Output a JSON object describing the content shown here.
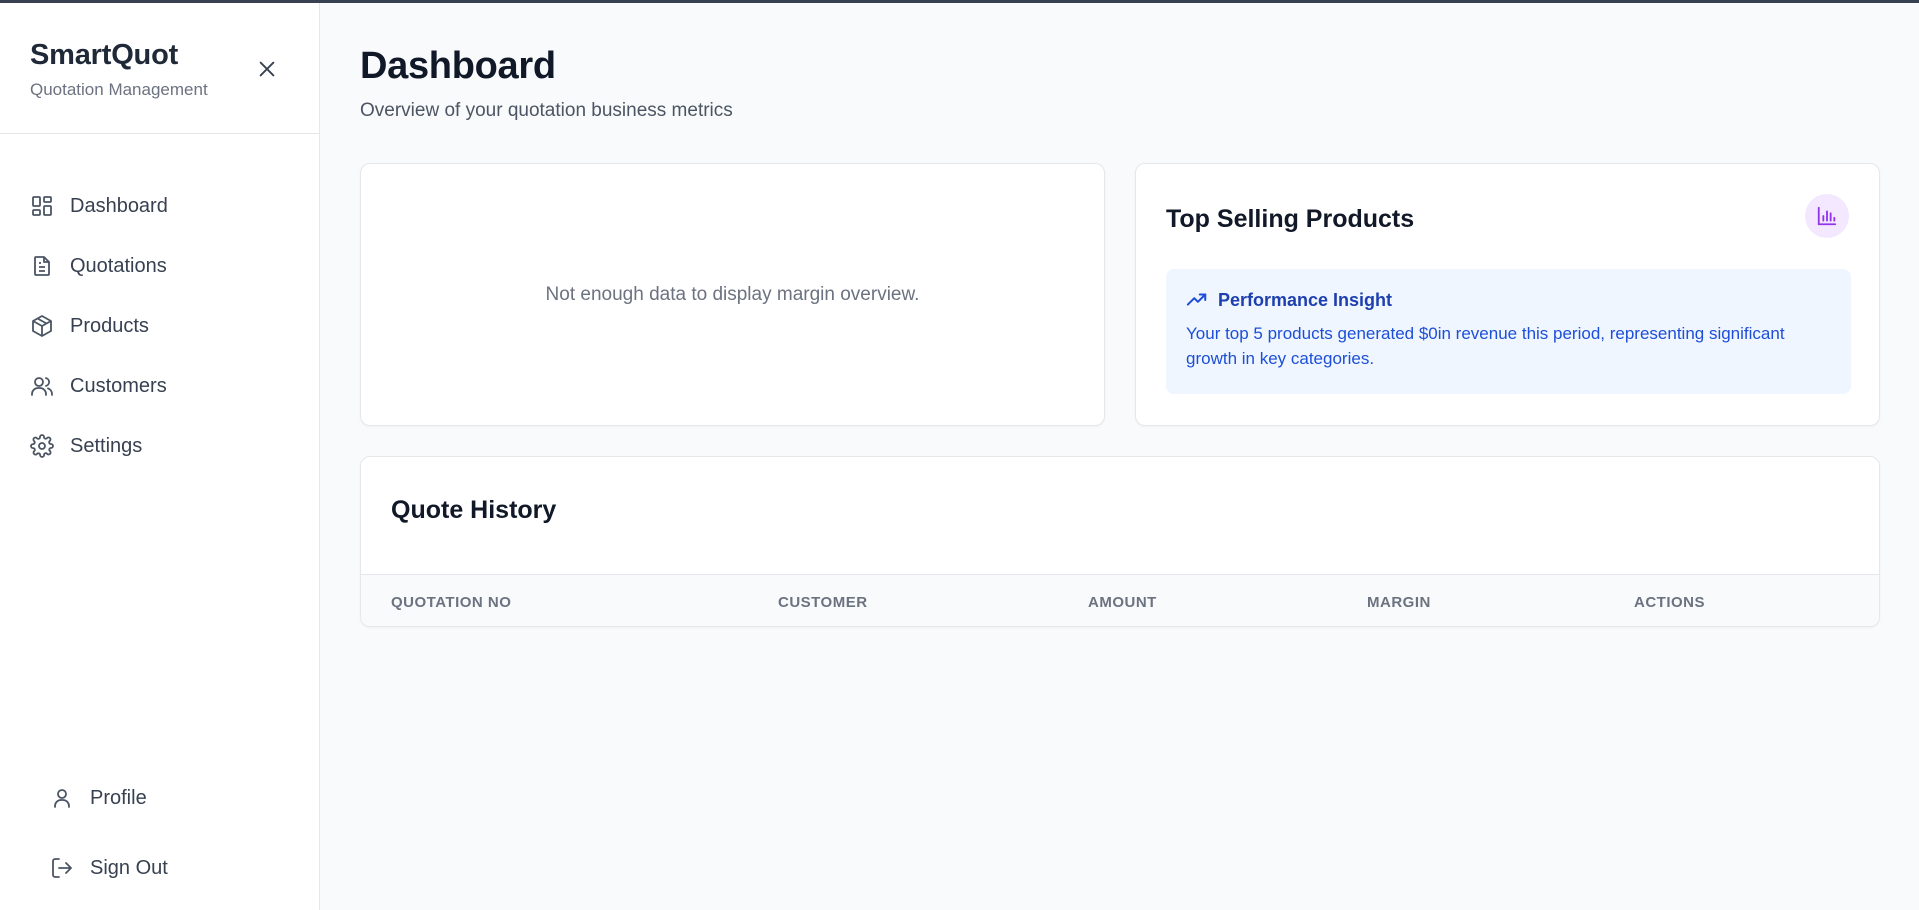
{
  "brand": {
    "title": "SmartQuot",
    "subtitle": "Quotation Management"
  },
  "sidebar": {
    "items": [
      {
        "label": "Dashboard",
        "icon": "dashboard-icon"
      },
      {
        "label": "Quotations",
        "icon": "document-icon"
      },
      {
        "label": "Products",
        "icon": "box-icon"
      },
      {
        "label": "Customers",
        "icon": "users-icon"
      },
      {
        "label": "Settings",
        "icon": "gear-icon"
      }
    ],
    "bottom": [
      {
        "label": "Profile",
        "icon": "user-icon"
      },
      {
        "label": "Sign Out",
        "icon": "sign-out-icon"
      }
    ]
  },
  "header": {
    "title": "Dashboard",
    "subtitle": "Overview of your quotation business metrics"
  },
  "margin_overview": {
    "empty_text": "Not enough data to display margin overview."
  },
  "top_products": {
    "title": "Top Selling Products",
    "insight_title": "Performance Insight",
    "insight_text": "Your top 5 products generated $0in revenue this period, representing significant growth in key categories."
  },
  "quote_history": {
    "title": "Quote History",
    "columns": [
      "QUOTATION NO",
      "CUSTOMER",
      "AMOUNT",
      "MARGIN",
      "ACTIONS"
    ]
  },
  "colors": {
    "accent_purple": "#9333ea",
    "insight_blue": "#1d4ed8",
    "insight_bg": "#eff6ff"
  }
}
